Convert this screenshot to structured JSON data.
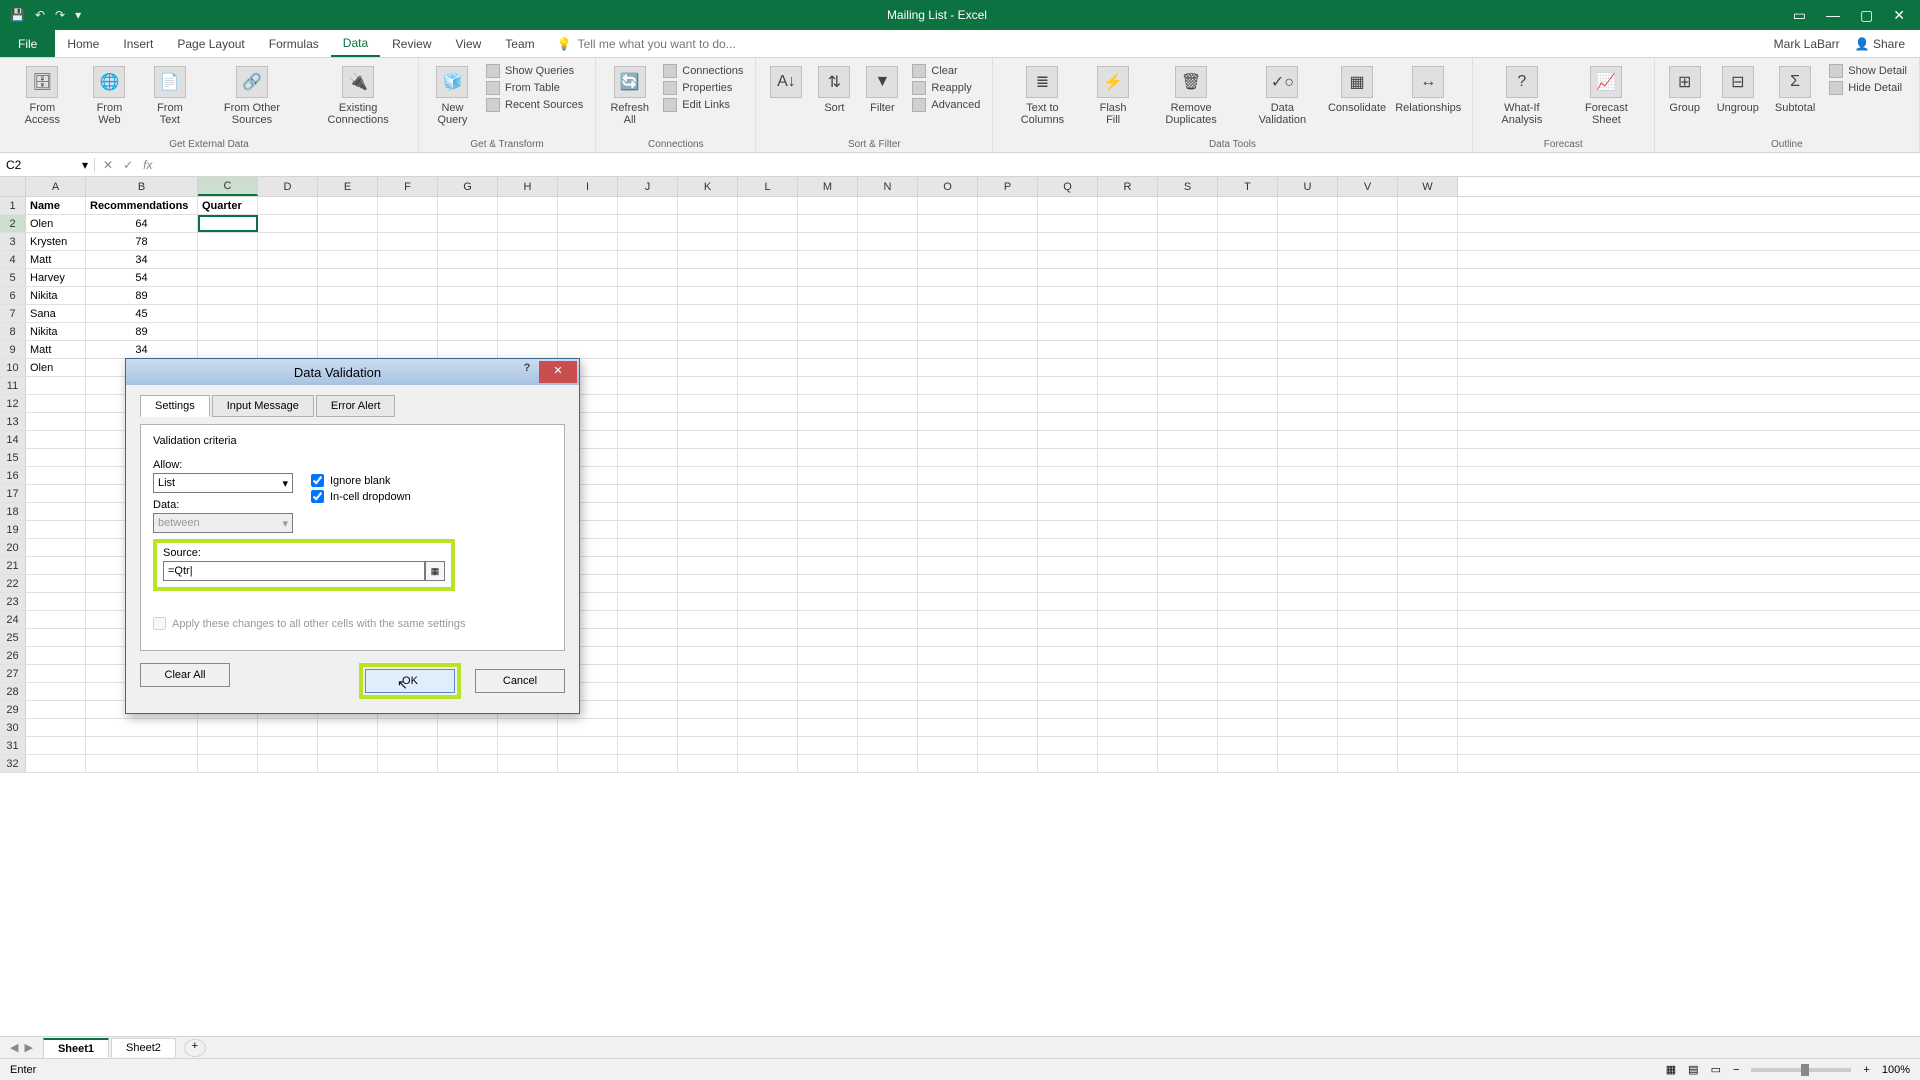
{
  "titlebar": {
    "title": "Mailing List - Excel"
  },
  "user": {
    "name": "Mark LaBarr",
    "share": "Share"
  },
  "tabs": {
    "file": "File",
    "home": "Home",
    "insert": "Insert",
    "pagelayout": "Page Layout",
    "formulas": "Formulas",
    "data": "Data",
    "review": "Review",
    "view": "View",
    "team": "Team",
    "tellme": "Tell me what you want to do..."
  },
  "ribbon": {
    "g1": {
      "label": "Get External Data",
      "b1": "From Access",
      "b2": "From Web",
      "b3": "From Text",
      "b4": "From Other Sources",
      "b5": "Existing Connections"
    },
    "g2": {
      "label": "Get & Transform",
      "b1": "New Query",
      "s1": "Show Queries",
      "s2": "From Table",
      "s3": "Recent Sources"
    },
    "g3": {
      "label": "Connections",
      "b1": "Refresh All",
      "s1": "Connections",
      "s2": "Properties",
      "s3": "Edit Links"
    },
    "g4": {
      "label": "Sort & Filter",
      "b1": "Sort",
      "b2": "Filter",
      "s1": "Clear",
      "s2": "Reapply",
      "s3": "Advanced"
    },
    "g5": {
      "label": "Data Tools",
      "b1": "Text to Columns",
      "b2": "Flash Fill",
      "b3": "Remove Duplicates",
      "b4": "Data Validation",
      "b5": "Consolidate",
      "b6": "Relationships"
    },
    "g6": {
      "label": "Forecast",
      "b1": "What-If Analysis",
      "b2": "Forecast Sheet"
    },
    "g7": {
      "label": "Outline",
      "b1": "Group",
      "b2": "Ungroup",
      "b3": "Subtotal",
      "s1": "Show Detail",
      "s2": "Hide Detail"
    }
  },
  "namebox": "C2",
  "columns": [
    "A",
    "B",
    "C",
    "D",
    "E",
    "F",
    "G",
    "H",
    "I",
    "J",
    "K",
    "L",
    "M",
    "N",
    "O",
    "P",
    "Q",
    "R",
    "S",
    "T",
    "U",
    "V",
    "W"
  ],
  "headers": {
    "A": "Name",
    "B": "Recommendations",
    "C": "Quarter"
  },
  "rows": [
    {
      "A": "Olen",
      "B": "64"
    },
    {
      "A": "Krysten",
      "B": "78"
    },
    {
      "A": "Matt",
      "B": "34"
    },
    {
      "A": "Harvey",
      "B": "54"
    },
    {
      "A": "Nikita",
      "B": "89"
    },
    {
      "A": "Sana",
      "B": "45"
    },
    {
      "A": "Nikita",
      "B": "89"
    },
    {
      "A": "Matt",
      "B": "34"
    },
    {
      "A": "Olen",
      "B": ""
    }
  ],
  "sheets": {
    "s1": "Sheet1",
    "s2": "Sheet2"
  },
  "status": {
    "mode": "Enter",
    "zoom": "100%"
  },
  "dialog": {
    "title": "Data Validation",
    "tabs": {
      "t1": "Settings",
      "t2": "Input Message",
      "t3": "Error Alert"
    },
    "criteria": "Validation criteria",
    "allow_lbl": "Allow:",
    "allow_val": "List",
    "data_lbl": "Data:",
    "data_val": "between",
    "ignore": "Ignore blank",
    "incell": "In-cell dropdown",
    "source_lbl": "Source:",
    "source_val": "=Qtr|",
    "apply": "Apply these changes to all other cells with the same settings",
    "clear": "Clear All",
    "ok": "OK",
    "cancel": "Cancel"
  }
}
